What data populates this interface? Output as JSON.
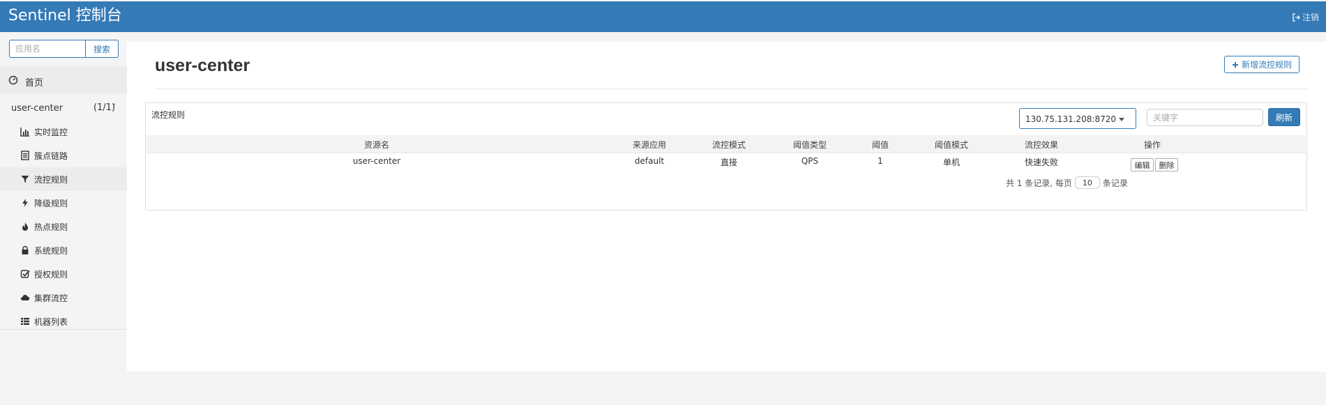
{
  "header": {
    "brand": "Sentinel 控制台",
    "logout_label": "注销"
  },
  "sidebar": {
    "search_placeholder": "应用名",
    "search_button": "搜索",
    "home_label": "首页",
    "app": {
      "name": "user-center",
      "count": "(1/1)"
    },
    "items": [
      {
        "label": "实时监控",
        "icon": "bar-chart-icon"
      },
      {
        "label": "簇点链路",
        "icon": "list-alt-icon"
      },
      {
        "label": "流控规则",
        "icon": "filter-icon",
        "active": true
      },
      {
        "label": "降级规则",
        "icon": "flash-icon"
      },
      {
        "label": "热点规则",
        "icon": "fire-icon"
      },
      {
        "label": "系统规则",
        "icon": "lock-icon"
      },
      {
        "label": "授权规则",
        "icon": "check-icon"
      },
      {
        "label": "集群流控",
        "icon": "cloud-icon"
      },
      {
        "label": "机器列表",
        "icon": "th-list-icon"
      }
    ]
  },
  "main": {
    "title": "user-center",
    "add_button": "新增流控规则",
    "panel": {
      "title": "流控规则",
      "machine": "130.75.131.208:8720",
      "keyword_placeholder": "关键字",
      "refresh_button": "刷新"
    },
    "table": {
      "headers": [
        "资源名",
        "来源应用",
        "流控模式",
        "阈值类型",
        "阈值",
        "阈值模式",
        "流控效果",
        "操作"
      ],
      "rows": [
        {
          "resource": "user-center",
          "origin": "default",
          "mode": "直接",
          "threshold_type": "QPS",
          "threshold": "1",
          "cluster_mode": "单机",
          "effect": "快速失败",
          "edit": "编辑",
          "delete": "删除"
        }
      ]
    },
    "pager": {
      "prefix": "共 1 条记录, 每页",
      "page_size": "10",
      "suffix": "条记录"
    }
  },
  "colors": {
    "primary": "#337ab7",
    "sidebar_bg": "#f4f4f4"
  }
}
